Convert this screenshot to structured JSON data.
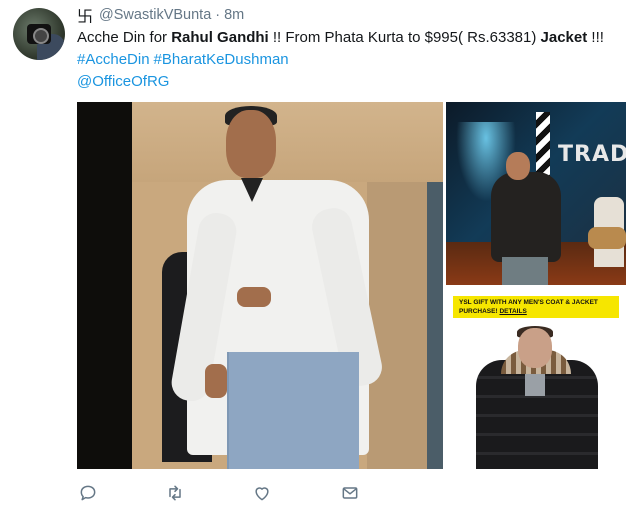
{
  "tweet": {
    "user": {
      "symbol": "卐",
      "handle": "@SwastikVBunta",
      "separator": "·",
      "time": "8m"
    },
    "text": {
      "part1": "Acche Din for ",
      "bold1": "Rahul Gandhi",
      "part2": " !! From Phata Kurta to $995( Rs.63381) ",
      "bold2": "Jacket",
      "part3": " !!!"
    },
    "hashtags": [
      "#AccheDin",
      "#BharatKeDushman"
    ],
    "mention": "@OfficeOfRG",
    "media": {
      "top_right_sign": "TRAD",
      "promo_line1": "YSL GIFT WITH ANY MEN'S COAT & JACKET",
      "promo_line2_prefix": "PURCHASE! ",
      "promo_link": "DETAILS"
    },
    "actions": [
      "reply-icon",
      "retweet-icon",
      "like-icon",
      "message-icon"
    ],
    "colors": {
      "link": "#1b95e0",
      "text": "#14171a",
      "meta": "#657786",
      "promo": "#f6e600"
    }
  }
}
